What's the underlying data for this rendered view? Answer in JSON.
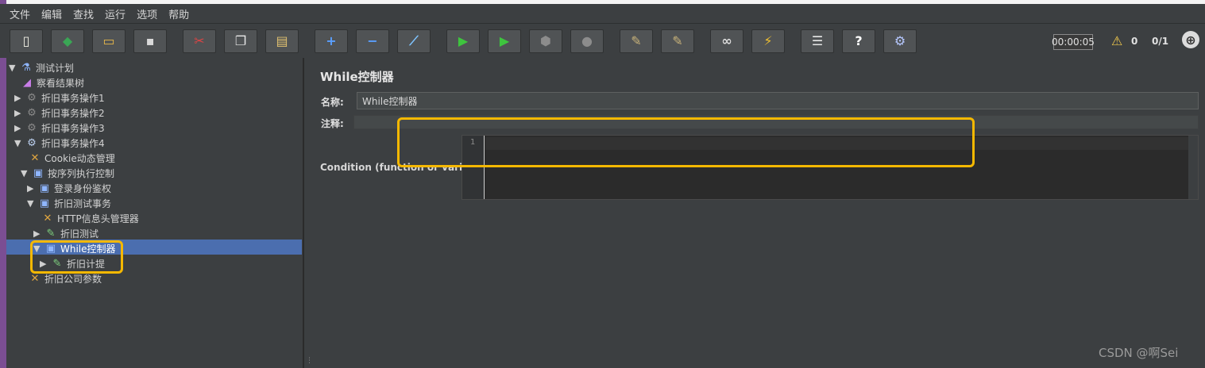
{
  "menu": [
    "文件",
    "编辑",
    "查找",
    "运行",
    "选项",
    "帮助"
  ],
  "toolbar": {
    "buttons": [
      {
        "name": "new-icon",
        "glyph": "▯",
        "color": "#f1f1e6"
      },
      {
        "name": "templates-icon",
        "glyph": "◆",
        "color": "#3aa655"
      },
      {
        "name": "open-icon",
        "glyph": "▭",
        "color": "#e8b84a"
      },
      {
        "name": "save-icon",
        "glyph": "▪",
        "color": "#d9d9d9"
      },
      {
        "name": "cut-icon",
        "glyph": "✂",
        "color": "#e04444"
      },
      {
        "name": "copy-icon",
        "glyph": "❐",
        "color": "#e8e8e8"
      },
      {
        "name": "paste-icon",
        "glyph": "▤",
        "color": "#e0c070"
      },
      {
        "name": "expand-icon",
        "glyph": "+",
        "color": "#5aa0ff"
      },
      {
        "name": "collapse-icon",
        "glyph": "−",
        "color": "#5aa0ff"
      },
      {
        "name": "toggle-icon",
        "glyph": "⟋",
        "color": "#7fc4ff"
      },
      {
        "name": "start-icon",
        "glyph": "▶",
        "color": "#3ec43e"
      },
      {
        "name": "start-no-pauses-icon",
        "glyph": "▶",
        "color": "#3ec43e"
      },
      {
        "name": "stop-icon",
        "glyph": "⬢",
        "color": "#8c8c8c"
      },
      {
        "name": "shutdown-icon",
        "glyph": "●",
        "color": "#8c8c8c"
      },
      {
        "name": "clear-icon",
        "glyph": "✎",
        "color": "#c9b37a"
      },
      {
        "name": "clear-all-icon",
        "glyph": "✎",
        "color": "#c9b37a"
      },
      {
        "name": "search-icon",
        "glyph": "∞",
        "color": "#dcdcdc"
      },
      {
        "name": "reset-search-icon",
        "glyph": "⚡",
        "color": "#f0c030"
      },
      {
        "name": "function-helper-icon",
        "glyph": "☰",
        "color": "#e6e6e6"
      },
      {
        "name": "help-icon",
        "glyph": "?",
        "color": "#ffffff"
      },
      {
        "name": "remote-icon",
        "glyph": "⚙",
        "color": "#b6c8ff"
      }
    ],
    "timer": "00:00:05",
    "warning_count": "0",
    "thread_ratio": "0/1"
  },
  "tree": {
    "nodes": [
      {
        "label": "测试计划",
        "arrow": "▼",
        "icon": "flask-icon",
        "glyph": "⚗",
        "color": "#8fb6ff"
      },
      {
        "label": "察看结果树",
        "arrow": "",
        "icon": "listener-icon",
        "glyph": "◢",
        "color": "#c87de8"
      },
      {
        "label": "折旧事务操作1",
        "arrow": "▶",
        "icon": "thread-group-icon",
        "glyph": "⚙",
        "color": "#8a8a8a"
      },
      {
        "label": "折旧事务操作2",
        "arrow": "▶",
        "icon": "thread-group-icon",
        "glyph": "⚙",
        "color": "#8a8a8a"
      },
      {
        "label": "折旧事务操作3",
        "arrow": "▶",
        "icon": "thread-group-icon",
        "glyph": "⚙",
        "color": "#8a8a8a"
      },
      {
        "label": "折旧事务操作4",
        "arrow": "▼",
        "icon": "thread-group-icon",
        "glyph": "⚙",
        "color": "#bcd0f0"
      },
      {
        "label": "Cookie动态管理",
        "arrow": "",
        "icon": "config-icon",
        "glyph": "✕",
        "color": "#e0a640"
      },
      {
        "label": "按序列执行控制",
        "arrow": "▼",
        "icon": "controller-icon",
        "glyph": "▣",
        "color": "#8fb6ff"
      },
      {
        "label": "登录身份鉴权",
        "arrow": "▶",
        "icon": "controller-icon",
        "glyph": "▣",
        "color": "#8fb6ff"
      },
      {
        "label": "折旧测试事务",
        "arrow": "▼",
        "icon": "controller-icon",
        "glyph": "▣",
        "color": "#8fb6ff"
      },
      {
        "label": "HTTP信息头管理器",
        "arrow": "",
        "icon": "config-icon",
        "glyph": "✕",
        "color": "#e0a640"
      },
      {
        "label": "折旧测试",
        "arrow": "▶",
        "icon": "sampler-icon",
        "glyph": "✎",
        "color": "#7ed07e"
      },
      {
        "label": "While控制器",
        "arrow": "▼",
        "icon": "controller-icon",
        "glyph": "▣",
        "color": "#8fb6ff"
      },
      {
        "label": "折旧计提",
        "arrow": "▶",
        "icon": "sampler-icon",
        "glyph": "✎",
        "color": "#7ed07e"
      },
      {
        "label": "折旧公司参数",
        "arrow": "",
        "icon": "config-icon",
        "glyph": "✕",
        "color": "#e0a640"
      }
    ]
  },
  "panel": {
    "title": "While控制器",
    "name_label": "名称:",
    "name_value": "While控制器",
    "comment_label": "注释:",
    "condition_label": "Condition (function or variable)",
    "line_number": "1"
  },
  "watermark": "CSDN @啊Sei",
  "colors": {
    "highlight": "#f5b800",
    "selection": "#4b6eaf"
  }
}
